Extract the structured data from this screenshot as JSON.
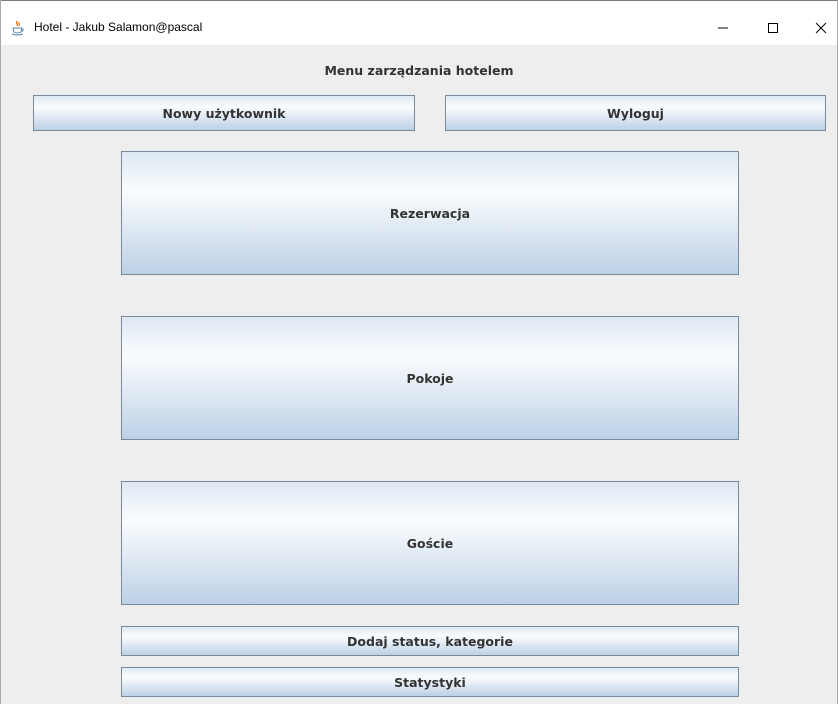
{
  "window": {
    "title": "Hotel - Jakub Salamon@pascal",
    "app_icon": "java-cup-icon",
    "controls": {
      "minimize_icon": "minimize-icon",
      "maximize_icon": "maximize-icon",
      "close_icon": "close-icon"
    }
  },
  "content": {
    "menu_label": "Menu zarządzania hotelem",
    "buttons": {
      "new_user": "Nowy użytkownik",
      "logout": "Wyloguj",
      "reservation": "Rezerwacja",
      "rooms": "Pokoje",
      "guests": "Goście",
      "add_status_category": "Dodaj status, kategorie",
      "statistics": "Statystyki"
    }
  },
  "colors": {
    "window_background": "#eeeeee",
    "titlebar_background": "#ffffff",
    "button_border": "#7a8a99",
    "button_gradient_light": "#f9fbfd",
    "button_gradient_dark": "#bcd0e6",
    "button_text": "#333333"
  }
}
